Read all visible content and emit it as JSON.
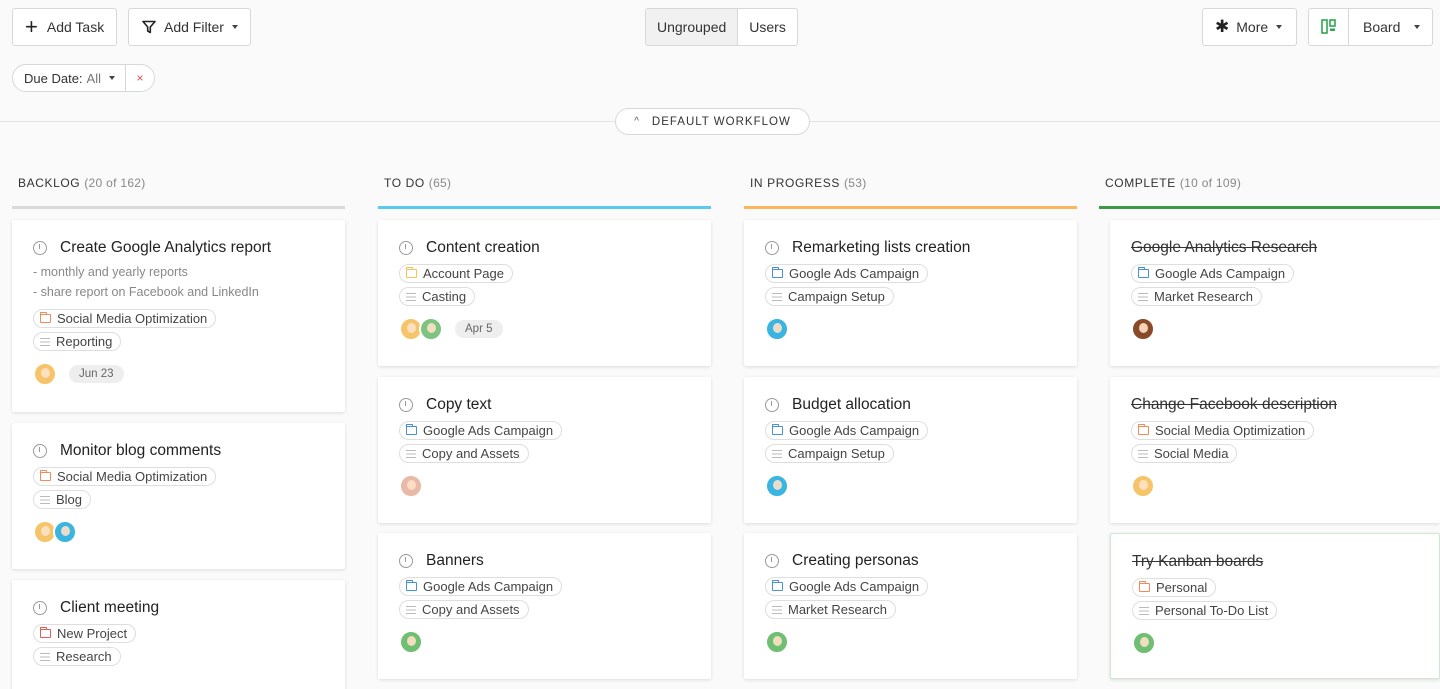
{
  "toolbar": {
    "add_task_label": "Add Task",
    "add_filter_label": "Add Filter",
    "grouping": [
      {
        "label": "Ungrouped",
        "active": true
      },
      {
        "label": "Users",
        "active": false
      }
    ],
    "more_label": "More",
    "view_label": "Board"
  },
  "filters": {
    "due_date_label": "Due Date:",
    "due_date_value": "All",
    "clear_symbol": "×"
  },
  "workflow": {
    "label": "DEFAULT WORKFLOW",
    "chevron": "^"
  },
  "colors": {
    "backlog": "#d9d9d9",
    "todo": "#5bc8f0",
    "in_progress": "#fdb65d",
    "complete": "#3e9a42",
    "project_tag_orange": "#f28b5b",
    "project_tag_blue": "#4a90d9",
    "project_tag_yellow": "#f3c55a",
    "project_tag_red": "#e35d5d"
  },
  "columns": [
    {
      "name": "BACKLOG",
      "count": "(20 of 162)",
      "cards": [
        {
          "title": "Create Google Analytics report",
          "done": false,
          "desc": [
            "- monthly and yearly reports",
            "- share report on Facebook and LinkedIn"
          ],
          "project": "Social Media Optimization",
          "project_color": "#f28b5b",
          "list": "Reporting",
          "date": "Jun 23",
          "avatars": [
            "#f6c56b"
          ]
        },
        {
          "title": "Monitor blog comments",
          "done": false,
          "desc": [],
          "project": "Social Media Optimization",
          "project_color": "#f28b5b",
          "list": "Blog",
          "date": "",
          "avatars": [
            "#f6c56b",
            "#3ab4e0"
          ]
        },
        {
          "title": "Client meeting",
          "done": false,
          "desc": [],
          "project": "New Project",
          "project_color": "#e35d5d",
          "list": "Research",
          "date": "",
          "avatars": []
        }
      ]
    },
    {
      "name": "TO DO",
      "count": "(65)",
      "cards": [
        {
          "title": "Content creation",
          "done": false,
          "desc": [],
          "project": "Account Page",
          "project_color": "#f3c55a",
          "list": "Casting",
          "date": "Apr 5",
          "avatars": [
            "#f6c56b",
            "#7cc47f"
          ]
        },
        {
          "title": "Copy text",
          "done": false,
          "desc": [],
          "project": "Google Ads Campaign",
          "project_color": "#4a90d9",
          "list": "Copy and Assets",
          "date": "",
          "avatars": [
            "#e8b9a6"
          ]
        },
        {
          "title": "Banners",
          "done": false,
          "desc": [],
          "project": "Google Ads Campaign",
          "project_color": "#4a90d9",
          "list": "Copy and Assets",
          "date": "",
          "avatars": [
            "#6fbf73"
          ]
        }
      ]
    },
    {
      "name": "IN PROGRESS",
      "count": "(53)",
      "cards": [
        {
          "title": "Remarketing lists creation",
          "done": false,
          "desc": [],
          "project": "Google Ads Campaign",
          "project_color": "#4a90d9",
          "list": "Campaign Setup",
          "date": "",
          "avatars": [
            "#3ab4e0"
          ]
        },
        {
          "title": "Budget allocation",
          "done": false,
          "desc": [],
          "project": "Google Ads Campaign",
          "project_color": "#4a90d9",
          "list": "Campaign Setup",
          "date": "",
          "avatars": [
            "#3ab4e0"
          ]
        },
        {
          "title": "Creating personas",
          "done": false,
          "desc": [],
          "project": "Google Ads Campaign",
          "project_color": "#4a90d9",
          "list": "Market Research",
          "date": "",
          "avatars": [
            "#6fbf73"
          ]
        }
      ]
    },
    {
      "name": "COMPLETE",
      "count": "(10 of 109)",
      "cards": [
        {
          "title": "Google Analytics Research",
          "done": true,
          "desc": [],
          "project": "Google Ads Campaign",
          "project_color": "#4a90d9",
          "list": "Market Research",
          "date": "",
          "avatars": [
            "#8a4a2a"
          ]
        },
        {
          "title": "Change Facebook description",
          "done": true,
          "desc": [],
          "project": "Social Media Optimization",
          "project_color": "#f28b5b",
          "list": "Social Media",
          "date": "",
          "avatars": [
            "#f6c56b"
          ]
        },
        {
          "title": "Try Kanban boards",
          "done": true,
          "desc": [],
          "project": "Personal",
          "project_color": "#f28b5b",
          "list": "Personal To-Do List",
          "date": "",
          "avatars": [
            "#6fbf73"
          ]
        }
      ]
    }
  ]
}
